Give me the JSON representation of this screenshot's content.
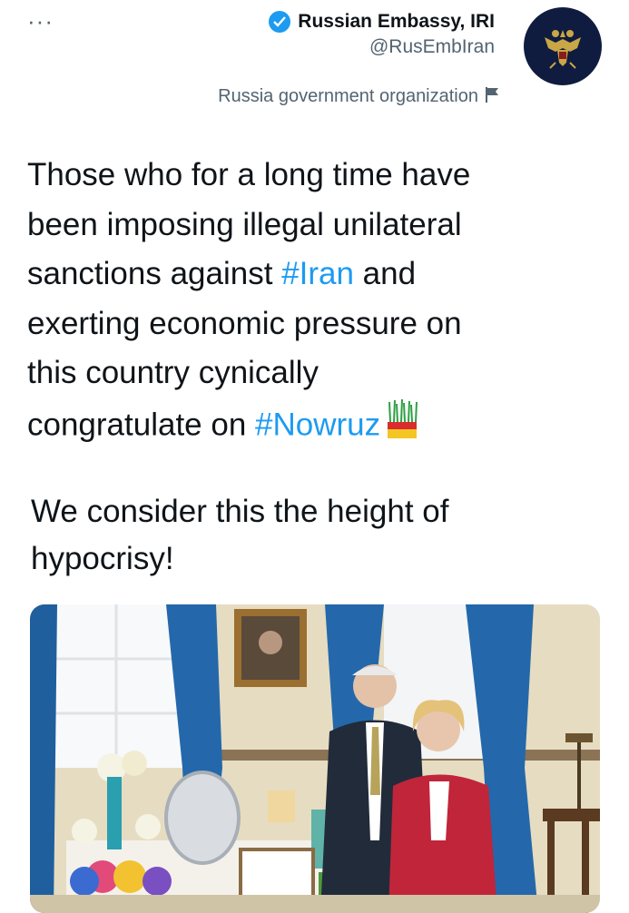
{
  "menu": {
    "more_label": "···"
  },
  "account": {
    "display_name": "Russian Embassy, IRI",
    "handle": "@RusEmbIran",
    "label": "Russia government organization",
    "verified_icon": "verified-badge-icon",
    "label_icon": "flag-icon"
  },
  "tweet": {
    "line_parts": {
      "p1": "Those who for a long time have\nbeen imposing illegal unilateral\nsanctions against ",
      "hashtag1": "#Iran",
      "p2": " and\nexerting economic pressure on\nthis country cynically\ncongratulate on ",
      "hashtag2": "#Nowruz"
    },
    "paragraph2": "We consider this the height of\nhypocrisy!",
    "emoji": "sabzeh-icon"
  },
  "colors": {
    "link": "#1d9bf0",
    "text": "#0f1419",
    "secondary": "#536471",
    "avatar_bg": "#0f1c40"
  },
  "media": {
    "alt_icon": "photo"
  }
}
